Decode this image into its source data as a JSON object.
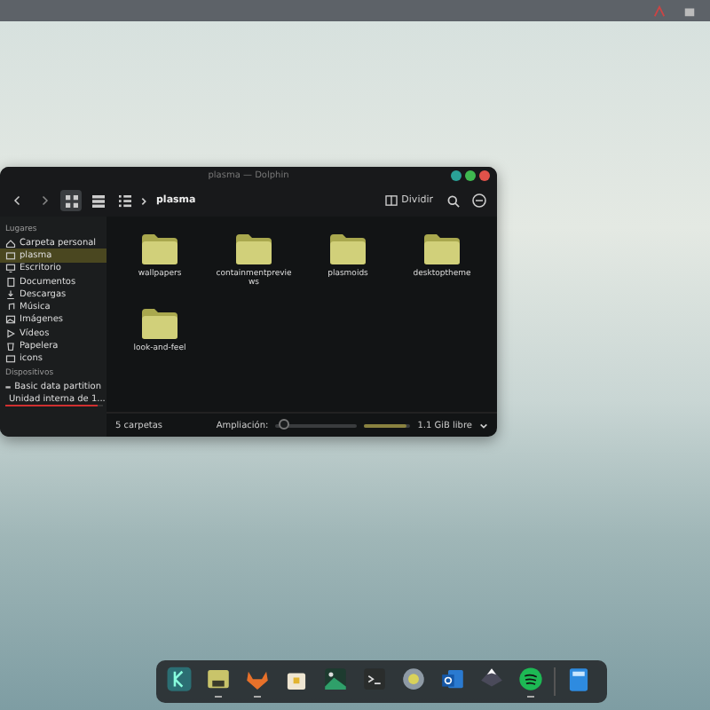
{
  "window": {
    "title": "plasma — Dolphin",
    "split_label": "Dividir",
    "breadcrumb": "plasma",
    "views": [
      {
        "kind": "icons",
        "selected": true
      },
      {
        "kind": "compact",
        "selected": false
      },
      {
        "kind": "details",
        "selected": false
      }
    ]
  },
  "sidebar": {
    "sections": [
      {
        "title": "Lugares",
        "items": [
          {
            "label": "Carpeta personal",
            "kind": "home",
            "selected": false
          },
          {
            "label": "plasma",
            "kind": "folder",
            "selected": true
          },
          {
            "label": "Escritorio",
            "kind": "desktop",
            "selected": false
          },
          {
            "label": "Documentos",
            "kind": "documents",
            "selected": false
          },
          {
            "label": "Descargas",
            "kind": "download",
            "selected": false
          },
          {
            "label": "Música",
            "kind": "music",
            "selected": false
          },
          {
            "label": "Imágenes",
            "kind": "image",
            "selected": false
          },
          {
            "label": "Vídeos",
            "kind": "video",
            "selected": false
          },
          {
            "label": "Papelera",
            "kind": "trash",
            "selected": false
          },
          {
            "label": "icons",
            "kind": "folder",
            "selected": false
          }
        ]
      },
      {
        "title": "Dispositivos",
        "items": [
          {
            "label": "Basic data partition",
            "kind": "drive",
            "selected": false
          },
          {
            "label": "Unidad interna de 1...",
            "kind": "drive",
            "selected": false,
            "level": 0.95
          }
        ]
      }
    ]
  },
  "files": [
    {
      "name": "wallpapers"
    },
    {
      "name": "containmentpreviews"
    },
    {
      "name": "plasmoids"
    },
    {
      "name": "desktoptheme"
    },
    {
      "name": "look-and-feel"
    }
  ],
  "status_bar": {
    "count": "5 carpetas",
    "zoom_label": "Ampliación:",
    "zoom": {
      "level": 0.1
    },
    "free_space": {
      "level": 0.92
    },
    "free_label": "1.1 GiB libre"
  },
  "dock": [
    {
      "kind": "launcher",
      "running": false
    },
    {
      "kind": "files",
      "running": true
    },
    {
      "kind": "fox",
      "running": true
    },
    {
      "kind": "store",
      "running": false
    },
    {
      "kind": "image",
      "running": false
    },
    {
      "kind": "terminal",
      "running": false
    },
    {
      "kind": "settings",
      "running": false
    },
    {
      "kind": "mail",
      "running": false
    },
    {
      "kind": "vector",
      "running": false
    },
    {
      "kind": "music",
      "running": true
    },
    {
      "kind": "separator"
    },
    {
      "kind": "calculator",
      "running": false
    }
  ]
}
